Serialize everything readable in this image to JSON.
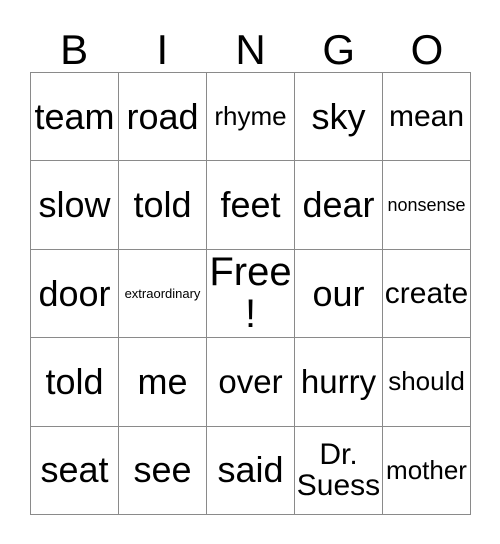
{
  "card": {
    "header_letters": [
      "B",
      "I",
      "N",
      "G",
      "O"
    ],
    "rows": [
      [
        {
          "text": "team",
          "size": "xl"
        },
        {
          "text": "road",
          "size": "xl"
        },
        {
          "text": "rhyme",
          "size": "sm"
        },
        {
          "text": "sky",
          "size": "xl"
        },
        {
          "text": "mean",
          "size": "md"
        }
      ],
      [
        {
          "text": "slow",
          "size": "xl"
        },
        {
          "text": "told",
          "size": "xl"
        },
        {
          "text": "feet",
          "size": "xl"
        },
        {
          "text": "dear",
          "size": "xl"
        },
        {
          "text": "nonsense",
          "size": "xs"
        }
      ],
      [
        {
          "text": "door",
          "size": "xl"
        },
        {
          "text": "extraordinary",
          "size": "xxs"
        },
        {
          "text": "Free!",
          "size": "xxl"
        },
        {
          "text": "our",
          "size": "xl"
        },
        {
          "text": "create",
          "size": "md"
        }
      ],
      [
        {
          "text": "told",
          "size": "xl"
        },
        {
          "text": "me",
          "size": "xl"
        },
        {
          "text": "over",
          "size": "lg"
        },
        {
          "text": "hurry",
          "size": "lg"
        },
        {
          "text": "should",
          "size": "sm"
        }
      ],
      [
        {
          "text": "seat",
          "size": "xl"
        },
        {
          "text": "see",
          "size": "xl"
        },
        {
          "text": "said",
          "size": "xl"
        },
        {
          "text": "Dr. Suess",
          "size": "md"
        },
        {
          "text": "mother",
          "size": "sm"
        }
      ]
    ],
    "colors": {
      "grid_line": "#8a8a8a",
      "text": "#000000",
      "background": "#ffffff"
    }
  }
}
